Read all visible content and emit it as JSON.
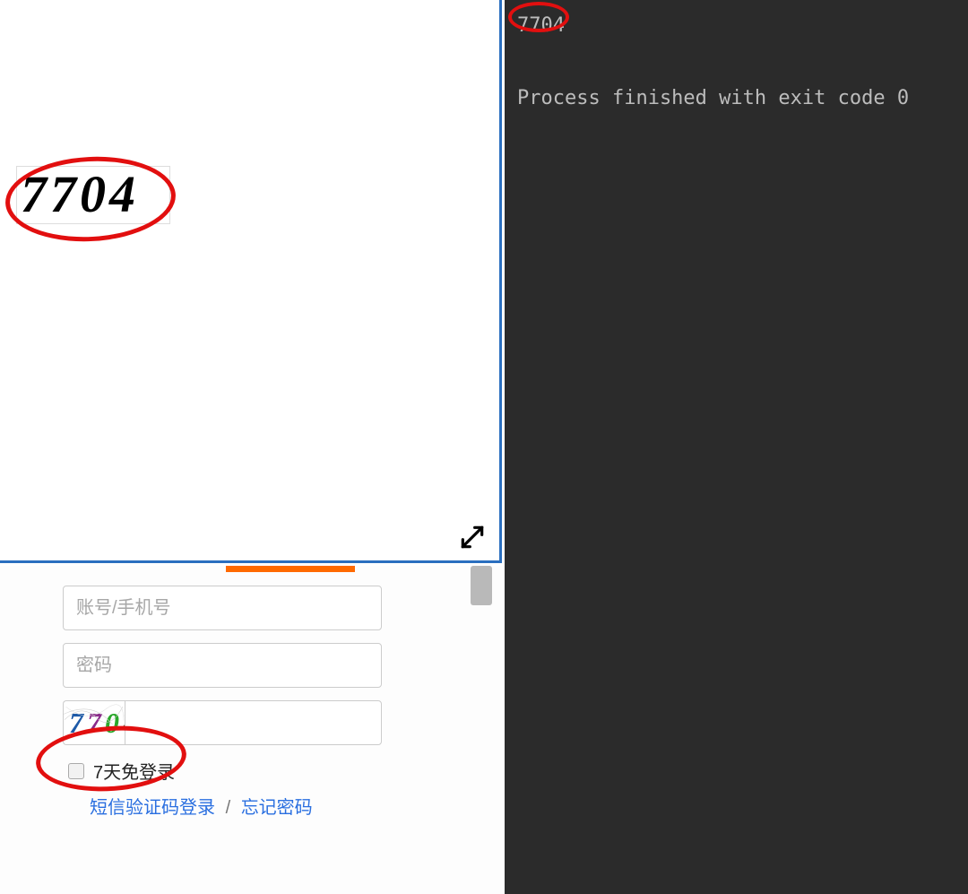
{
  "captcha": {
    "value": "7704",
    "digits": [
      "7",
      "7",
      "0",
      "4"
    ]
  },
  "console": {
    "output": "7704",
    "exit_line": "Process finished with exit code 0"
  },
  "login": {
    "username_placeholder": "账号/手机号",
    "password_placeholder": "密码",
    "captcha_placeholder": "",
    "remember_label": "7天免登录",
    "sms_login": "短信验证码登录",
    "separator": "/",
    "forgot": "忘记密码"
  }
}
